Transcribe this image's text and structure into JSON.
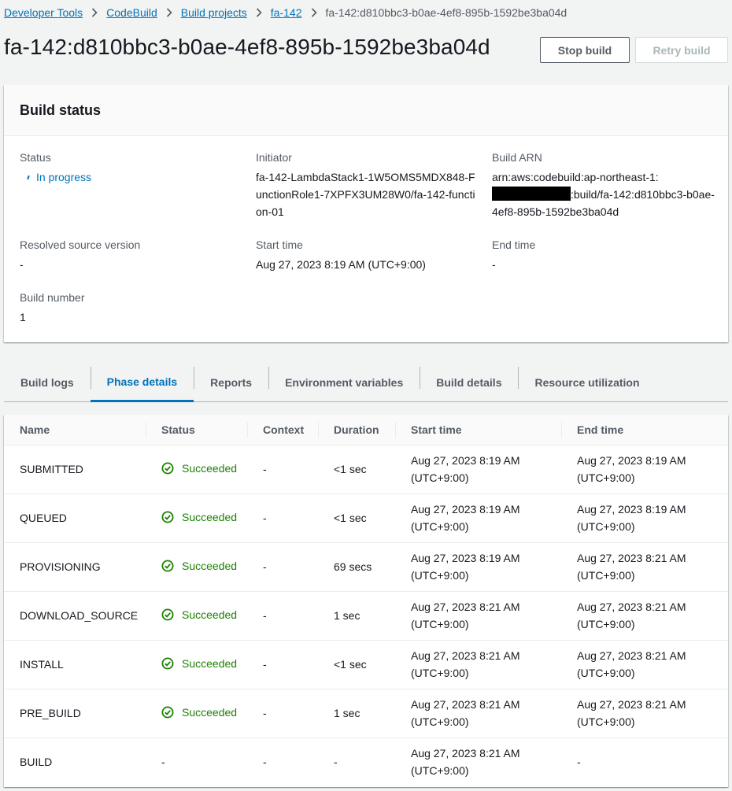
{
  "breadcrumb": [
    {
      "label": "Developer Tools",
      "link": true
    },
    {
      "label": "CodeBuild",
      "link": true
    },
    {
      "label": "Build projects",
      "link": true
    },
    {
      "label": "fa-142",
      "link": true
    },
    {
      "label": "fa-142:d810bbc3-b0ae-4ef8-895b-1592be3ba04d",
      "link": false
    }
  ],
  "title": "fa-142:d810bbc3-b0ae-4ef8-895b-1592be3ba04d",
  "buttons": {
    "stop": "Stop build",
    "retry": "Retry build"
  },
  "build_status": {
    "heading": "Build status",
    "status_label": "Status",
    "status_value": "In progress",
    "initiator_label": "Initiator",
    "initiator_value": "fa-142-LambdaStack1-1W5OMS5MDX848-FunctionRole1-7XPFX3UM28W0/fa-142-function-01",
    "arn_label": "Build ARN",
    "arn_prefix": "arn:aws:codebuild:ap-northeast-1:",
    "arn_suffix": ":build/fa-142:d810bbc3-b0ae-4ef8-895b-1592be3ba04d",
    "resolved_label": "Resolved source version",
    "resolved_value": "-",
    "start_label": "Start time",
    "start_value": "Aug 27, 2023 8:19 AM (UTC+9:00)",
    "end_label": "End time",
    "end_value": "-",
    "number_label": "Build number",
    "number_value": "1"
  },
  "tabs": [
    "Build logs",
    "Phase details",
    "Reports",
    "Environment variables",
    "Build details",
    "Resource utilization"
  ],
  "active_tab": 1,
  "phase_table": {
    "columns": [
      "Name",
      "Status",
      "Context",
      "Duration",
      "Start time",
      "End time"
    ],
    "rows": [
      {
        "name": "SUBMITTED",
        "status": "Succeeded",
        "context": "-",
        "duration": "<1 sec",
        "start": "Aug 27, 2023 8:19 AM",
        "start_tz": "(UTC+9:00)",
        "end": "Aug 27, 2023 8:19 AM",
        "end_tz": "(UTC+9:00)"
      },
      {
        "name": "QUEUED",
        "status": "Succeeded",
        "context": "-",
        "duration": "<1 sec",
        "start": "Aug 27, 2023 8:19 AM",
        "start_tz": "(UTC+9:00)",
        "end": "Aug 27, 2023 8:19 AM",
        "end_tz": "(UTC+9:00)"
      },
      {
        "name": "PROVISIONING",
        "status": "Succeeded",
        "context": "-",
        "duration": "69 secs",
        "start": "Aug 27, 2023 8:19 AM",
        "start_tz": "(UTC+9:00)",
        "end": "Aug 27, 2023 8:21 AM",
        "end_tz": "(UTC+9:00)"
      },
      {
        "name": "DOWNLOAD_SOURCE",
        "status": "Succeeded",
        "context": "-",
        "duration": "1 sec",
        "start": "Aug 27, 2023 8:21 AM",
        "start_tz": "(UTC+9:00)",
        "end": "Aug 27, 2023 8:21 AM",
        "end_tz": "(UTC+9:00)"
      },
      {
        "name": "INSTALL",
        "status": "Succeeded",
        "context": "-",
        "duration": "<1 sec",
        "start": "Aug 27, 2023 8:21 AM",
        "start_tz": "(UTC+9:00)",
        "end": "Aug 27, 2023 8:21 AM",
        "end_tz": "(UTC+9:00)"
      },
      {
        "name": "PRE_BUILD",
        "status": "Succeeded",
        "context": "-",
        "duration": "1 sec",
        "start": "Aug 27, 2023 8:21 AM",
        "start_tz": "(UTC+9:00)",
        "end": "Aug 27, 2023 8:21 AM",
        "end_tz": "(UTC+9:00)"
      },
      {
        "name": "BUILD",
        "status": "-",
        "context": "-",
        "duration": "-",
        "start": "Aug 27, 2023 8:21 AM",
        "start_tz": "(UTC+9:00)",
        "end": "-",
        "end_tz": ""
      }
    ]
  },
  "colors": {
    "link": "#0073bb",
    "success": "#1d8102",
    "text": "#16191f",
    "muted": "#545b64"
  }
}
